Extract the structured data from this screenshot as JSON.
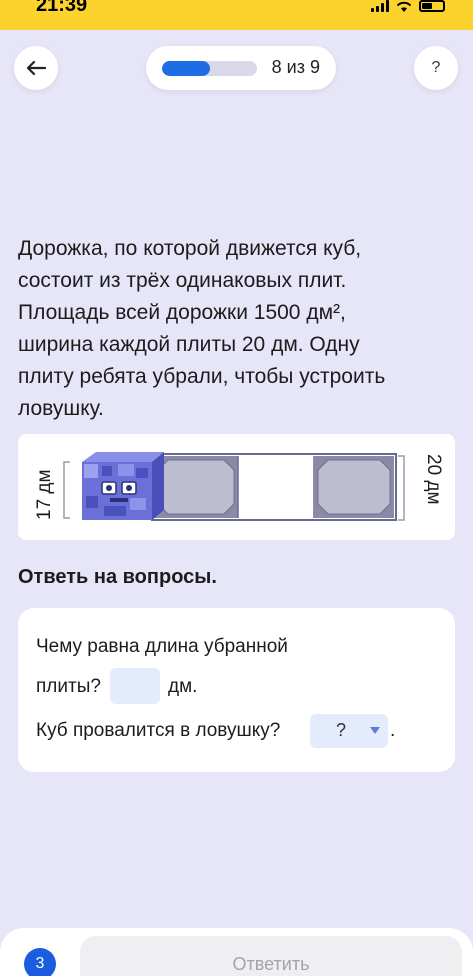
{
  "status_bar": {
    "time": "21:39"
  },
  "header": {
    "progress": {
      "text": "8 из 9",
      "fraction": 0.5
    },
    "help_label": "?"
  },
  "problem": {
    "lines": [
      "Дорожка, по которой движется куб,",
      "состоит из трёх одинаковых плит.",
      "Площадь всей дорожки 1500 дм²,",
      "ширина каждой плиты 20 дм. Одну",
      "плиту ребята убрали, чтобы устроить",
      "ловушку."
    ]
  },
  "illustration": {
    "label_left": "17 дм",
    "label_right": "20 дм"
  },
  "questions": {
    "title": "Ответь на вопросы.",
    "q1_part1": "Чему равна длина убранной",
    "q1_part2": "плиты?",
    "q1_unit": "дм.",
    "q1_value": "",
    "q2_text": "Куб провалится в ловушку?",
    "q2_selected": "?",
    "q2_end": "."
  },
  "footer": {
    "step": "3",
    "submit_label": "Ответить"
  },
  "colors": {
    "background": "#e6e6f8",
    "status_bar": "#fcd22d",
    "accent": "#1e6de5",
    "input_bg": "#e3ebfd"
  }
}
